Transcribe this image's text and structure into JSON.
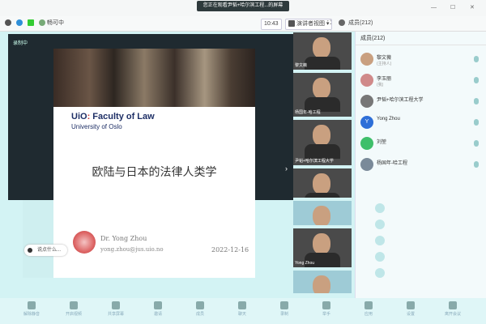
{
  "window": {
    "title": "您正在观看尹韬+哈尔滨工程...的屏幕",
    "time": "10:43",
    "minimize": "—",
    "maximize": "☐",
    "close": "✕"
  },
  "toolbar": {
    "network": "畅可中",
    "layout": "演讲者视图",
    "members_label": "成员(212)"
  },
  "stage": {
    "recording": "录制中",
    "slide": {
      "logo": "UiO",
      "logo_dots": ":",
      "faculty": "Faculty of Law",
      "university": "University of Oslo",
      "title": "欧陆与日本的法律人类学",
      "presenter": "Dr. Yong Zhou",
      "email": "yong.zhou@jus.uio.no",
      "date": "2022-12-16"
    },
    "chat_prompt": "说点什么..."
  },
  "thumbs": [
    {
      "caption": "黎文薇"
    },
    {
      "caption": "杨国年-哈工程"
    },
    {
      "caption": "尹韬+哈尔滨工程大学"
    },
    {
      "caption": ""
    },
    {
      "caption": ""
    },
    {
      "caption": "Yong Zhou"
    },
    {
      "caption": ""
    }
  ],
  "thumb_nav": "›",
  "participants": [
    {
      "name": "黎文薇",
      "sub": "(主持人)",
      "color": "#c9a080"
    },
    {
      "name": "李玉丽",
      "sub": "(我)",
      "color": "#d08a8a"
    },
    {
      "name": "尹韬+哈尔滨工程大学",
      "sub": "",
      "color": "#777"
    },
    {
      "name": "Yong Zhou",
      "sub": "",
      "color": "#2e6fd8",
      "initial": "Y"
    },
    {
      "name": "刘堃",
      "sub": "",
      "color": "#3fbf6a"
    },
    {
      "name": "杨国年-哈工程",
      "sub": "",
      "color": "#7a8a99"
    }
  ],
  "controls": [
    {
      "label": "解除静音",
      "icon": "mic-icon"
    },
    {
      "label": "开启视频",
      "icon": "camera-icon"
    },
    {
      "label": "共享屏幕",
      "icon": "screen-share-icon"
    },
    {
      "label": "邀请",
      "icon": "invite-icon"
    },
    {
      "label": "成员",
      "icon": "members-icon"
    },
    {
      "label": "聊天",
      "icon": "chat-icon"
    },
    {
      "label": "录制",
      "icon": "record-icon"
    },
    {
      "label": "举手",
      "icon": "raise-hand-icon"
    },
    {
      "label": "应用",
      "icon": "apps-icon"
    },
    {
      "label": "设置",
      "icon": "settings-icon"
    },
    {
      "label": "离开会议",
      "icon": "leave-icon"
    }
  ]
}
